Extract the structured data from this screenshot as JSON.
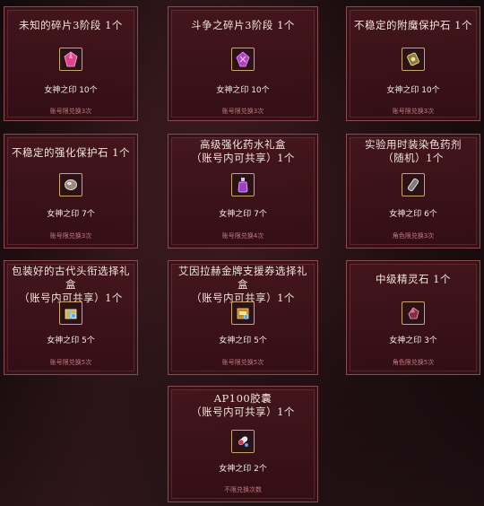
{
  "cards": [
    {
      "title_lines": [
        "未知的碎片3阶段 1个"
      ],
      "icon": "pink-crystal-shard-icon",
      "cost": "女神之印 10个",
      "limit": "账号限兑换3次"
    },
    {
      "title_lines": [
        "斗争之碎片3阶段 1个"
      ],
      "icon": "purple-crystal-shard-icon",
      "cost": "女神之印 10个",
      "limit": "账号限兑换3次"
    },
    {
      "title_lines": [
        "不稳定的附魔保护石 1个"
      ],
      "icon": "gold-protection-stone-icon",
      "cost": "女神之印 10个",
      "limit": "账号限兑换3次"
    },
    {
      "title_lines": [
        "不稳定的强化保护石 1个"
      ],
      "icon": "silver-protection-stone-icon",
      "cost": "女神之印 7个",
      "limit": "账号限兑换3次"
    },
    {
      "title_lines": [
        "高级强化药水礼盒",
        "（账号内可共享）1个"
      ],
      "icon": "purple-potion-icon",
      "cost": "女神之印 7个",
      "limit": "账号限兑换4次"
    },
    {
      "title_lines": [
        "实验用时装染色药剂",
        "（随机）1个"
      ],
      "icon": "dye-bottle-icon",
      "cost": "女神之印 6个",
      "limit": "角色限兑换3次"
    },
    {
      "title_lines": [
        "包装好的古代头衔选择礼盒",
        "（账号内可共享）1个"
      ],
      "icon": "gift-box-icon",
      "cost": "女神之印 5个",
      "limit": "账号限兑换5次"
    },
    {
      "title_lines": [
        "艾因拉赫金牌支援券选择礼盒",
        "（账号内可共享）1个"
      ],
      "icon": "gold-ticket-box-icon",
      "cost": "女神之印 5个",
      "limit": "账号限兑换5次"
    },
    {
      "title_lines": [
        "中级精灵石 1个"
      ],
      "icon": "spirit-stone-icon",
      "cost": "女神之印 3个",
      "limit": "角色限兑换5次"
    },
    {
      "title_lines": [
        "AP100胶囊",
        "（账号内可共享）1个"
      ],
      "icon": "ap-capsule-icon",
      "cost": "女神之印 2个",
      "limit": "不限兑换次数"
    }
  ]
}
